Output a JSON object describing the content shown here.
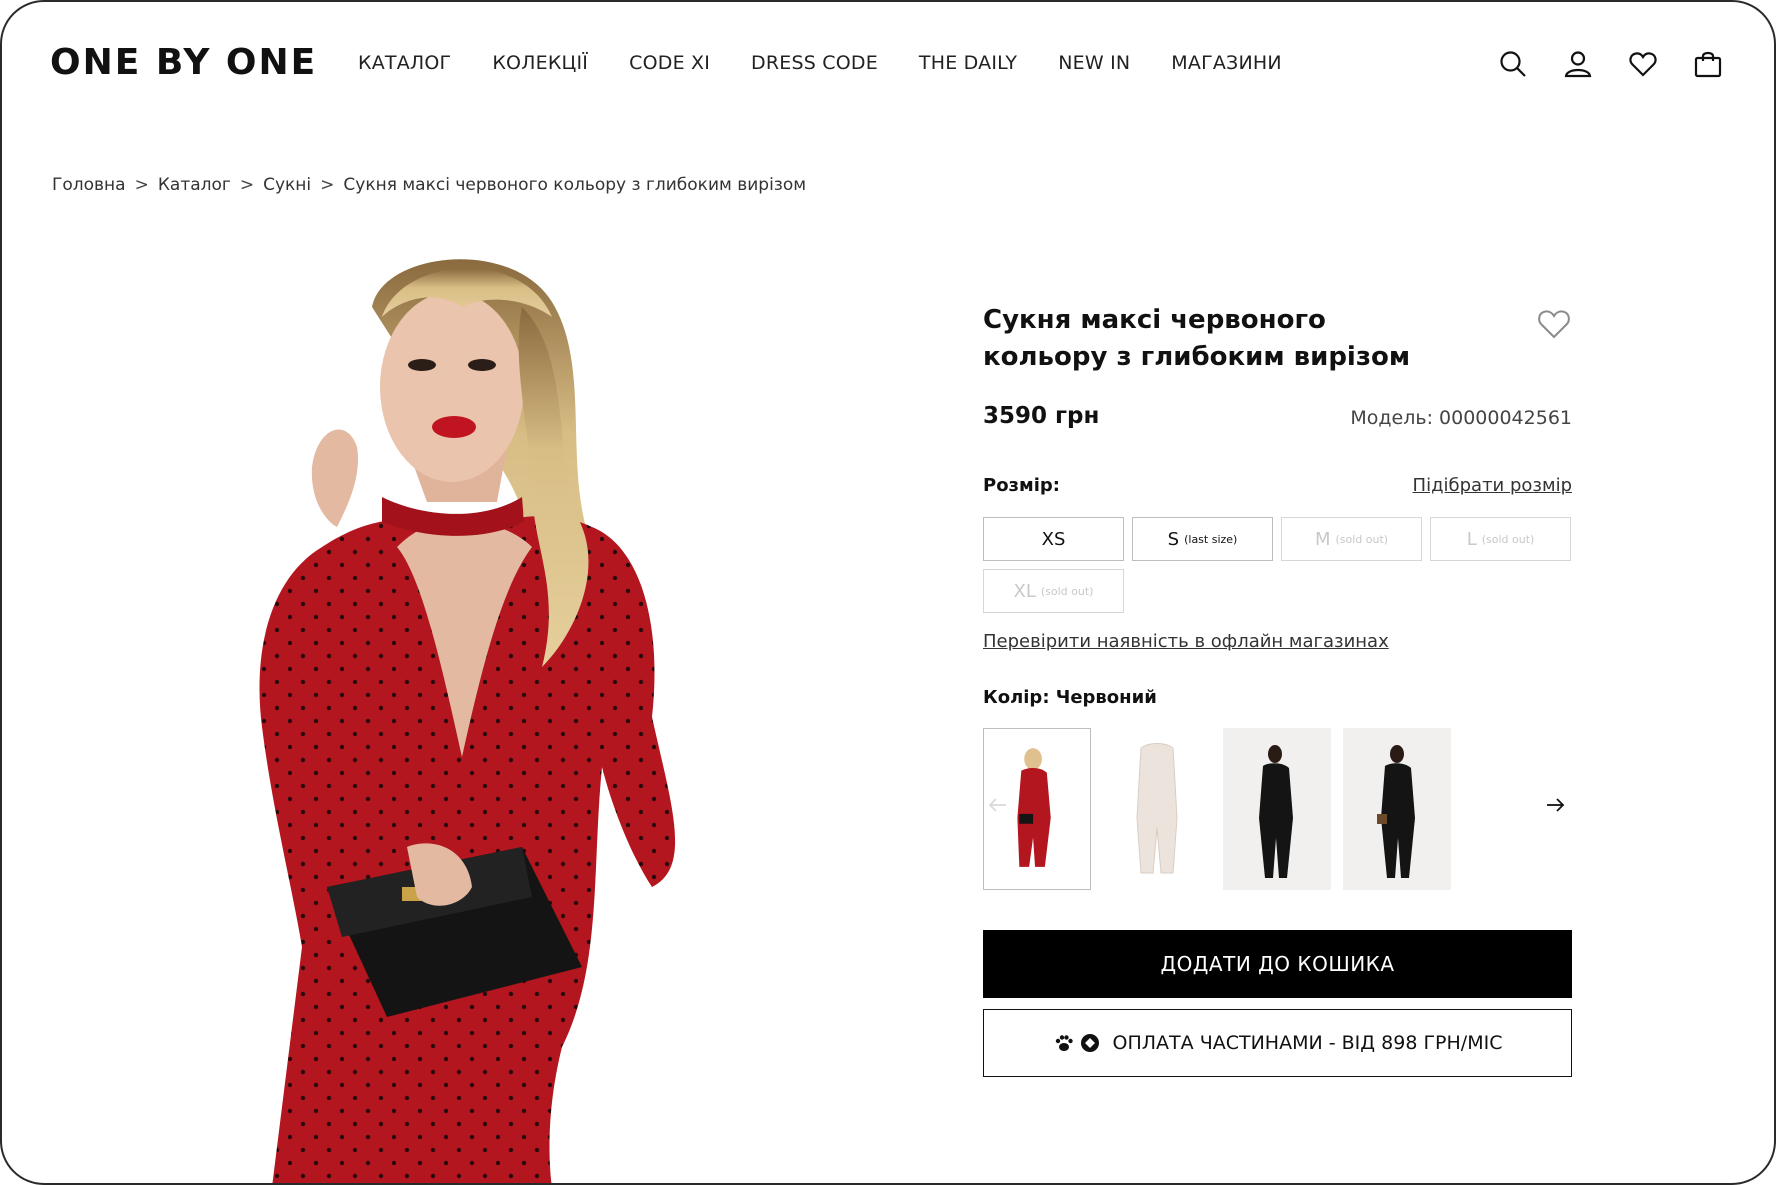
{
  "header": {
    "logo": "ONE BY ONE",
    "nav": [
      "КАТАЛОГ",
      "КОЛЕКЦІЇ",
      "CODE XI",
      "DRESS CODE",
      "THE DAILY",
      "NEW IN",
      "МАГАЗИНИ"
    ],
    "icons": [
      "search-icon",
      "user-icon",
      "heart-icon",
      "bag-icon"
    ]
  },
  "breadcrumb": {
    "items": [
      "Головна",
      "Каталог",
      "Сукні"
    ],
    "separator": ">",
    "current": "Сукня максі червоного кольору з глибоким вирізом"
  },
  "product": {
    "title": "Сукня максі червоного кольору з глибоким вирізом",
    "price": "3590 грн",
    "model": "Модель: 00000042561",
    "size_label": "Розмір:",
    "size_guide": "Підібрати розмір",
    "sizes": [
      {
        "label": "XS",
        "note": ""
      },
      {
        "label": "S",
        "note": "(last size)"
      },
      {
        "label": "M",
        "note": "(sold out)"
      },
      {
        "label": "L",
        "note": "(sold out)"
      },
      {
        "label": "XL",
        "note": "(sold out)"
      }
    ],
    "offline_link": "Перевірити наявність в офлайн магазинах",
    "color_label": "Колір: Червоний",
    "add_to_cart": "ДОДАТИ ДО КОШИКА",
    "installments": "ОПЛАТА ЧАСТИНАМИ - ВІД 898 ГРН/МІС"
  },
  "colors": {
    "dress_red": "#b3161f",
    "dress_cream": "#ece4dc",
    "dress_black": "#141414",
    "button_black": "#000000"
  }
}
